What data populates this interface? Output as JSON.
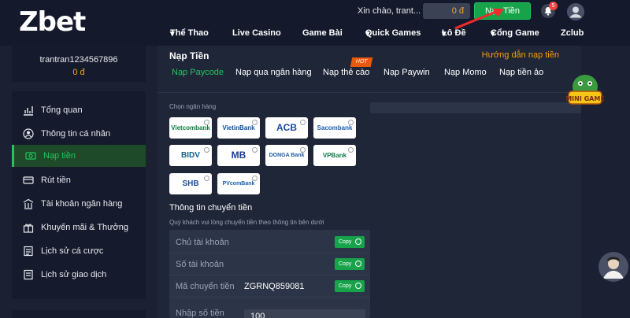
{
  "header": {
    "logo": "Zbet",
    "greeting": "Xin chào, trant...",
    "balance": "0 đ",
    "deposit_button": "Nạp Tiền",
    "notification_count": "5",
    "nav": [
      "Thể Thao",
      "Live Casino",
      "Game Bài",
      "Quick Games",
      "Lô Đề",
      "Cổng Game",
      "Zclub"
    ]
  },
  "sidebar": {
    "username": "trantran1234567896",
    "balance": "0 đ",
    "items": [
      {
        "label": "Tổng quan",
        "icon": "chart-icon"
      },
      {
        "label": "Thông tin cá nhân",
        "icon": "user-icon"
      },
      {
        "label": "Nạp tiền",
        "icon": "deposit-icon"
      },
      {
        "label": "Rút tiền",
        "icon": "withdraw-icon"
      },
      {
        "label": "Tài khoản ngân hàng",
        "icon": "bank-icon"
      },
      {
        "label": "Khuyến mãi & Thưởng",
        "icon": "gift-icon"
      },
      {
        "label": "Lịch sử cá cược",
        "icon": "bet-history-icon"
      },
      {
        "label": "Lịch sử giao dịch",
        "icon": "transaction-history-icon"
      }
    ]
  },
  "main": {
    "title": "Nạp Tiền",
    "guide_link": "Hướng dẫn nạp tiền",
    "tabs": [
      "Nạp Paycode",
      "Nạp qua ngân hàng",
      "Nạp thẻ cào",
      "Nạp Paywin",
      "Nạp Momo",
      "Nạp tiền ảo"
    ],
    "hot_badge": "HOT",
    "bank_label": "Chọn ngân hàng",
    "banks": [
      "Vietcombank",
      "VietinBank",
      "ACB",
      "Sacombank",
      "BIDV",
      "MB",
      "DONGA Bank",
      "VPBank",
      "SHB",
      "PVcomBank"
    ],
    "transfer_title": "Thông tin chuyển tiền",
    "transfer_subtitle": "Quý khách vui lòng chuyển tiền theo thông tin bên dưới",
    "rows": [
      {
        "label": "Chủ tài khoản",
        "value": ""
      },
      {
        "label": "Số tài khoản",
        "value": ""
      },
      {
        "label": "Mã chuyển tiền",
        "value": "ZGRNQ859081"
      },
      {
        "label": "Nhập số tiền",
        "value": "100"
      }
    ],
    "copy_label": "Copy"
  },
  "widgets": {
    "mini_game": "MINI GAME"
  },
  "colors": {
    "accent_green": "#16a34a",
    "accent_orange": "#f59e0b",
    "background": "#1b2133"
  }
}
